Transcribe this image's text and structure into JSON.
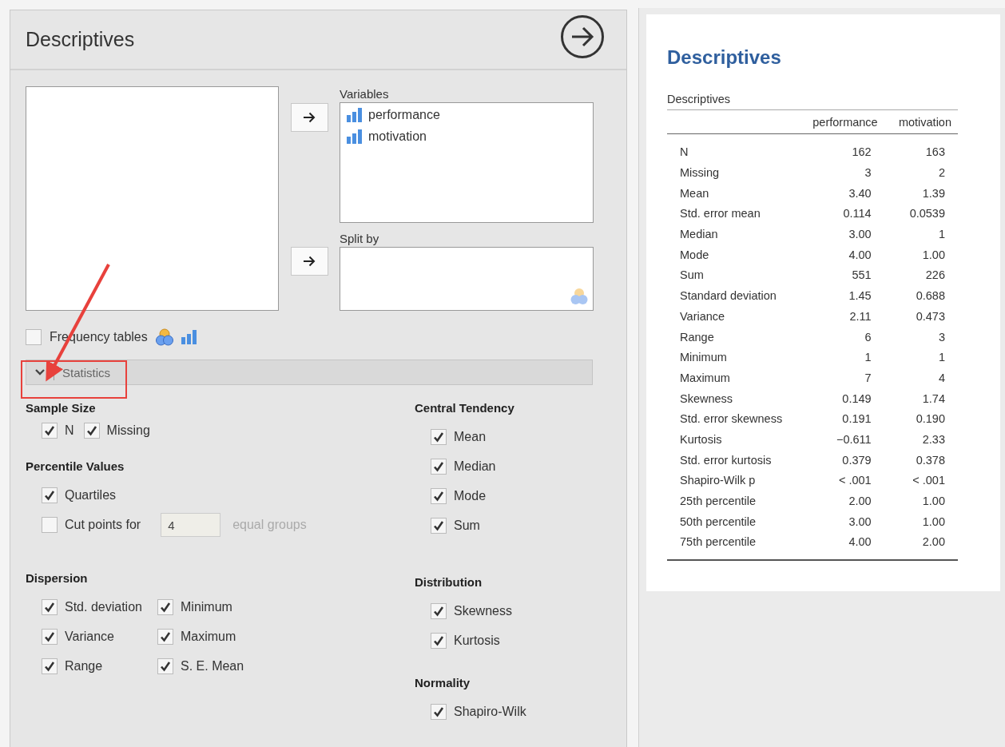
{
  "analysis_panel": {
    "title": "Descriptives",
    "variables": {
      "label": "Variables",
      "items": [
        {
          "name": "performance"
        },
        {
          "name": "motivation"
        }
      ]
    },
    "split_by": {
      "label": "Split by"
    },
    "frequency_tables": {
      "label": "Frequency tables",
      "checked": false
    },
    "statistics_section": {
      "label": "Statistics",
      "expanded": true,
      "left_groups": [
        {
          "title": "Sample Size",
          "kind": "inline",
          "items": [
            {
              "kind": "checkbox",
              "label": "N",
              "checked": true
            },
            {
              "kind": "checkbox",
              "label": "Missing",
              "checked": true
            }
          ]
        },
        {
          "title": "Percentile Values",
          "kind": "stack",
          "items": [
            {
              "kind": "checkbox",
              "label": "Quartiles",
              "checked": true
            },
            {
              "kind": "cut_points",
              "label": "Cut points for",
              "value": "4",
              "suffix": "equal groups",
              "checked": false
            }
          ]
        },
        {
          "title": "Dispersion",
          "kind": "grid",
          "items": [
            {
              "kind": "checkbox",
              "label": "Std. deviation",
              "checked": true
            },
            {
              "kind": "checkbox",
              "label": "Minimum",
              "checked": true
            },
            {
              "kind": "checkbox",
              "label": "Variance",
              "checked": true
            },
            {
              "kind": "checkbox",
              "label": "Maximum",
              "checked": true
            },
            {
              "kind": "checkbox",
              "label": "Range",
              "checked": true
            },
            {
              "kind": "checkbox",
              "label": "S. E. Mean",
              "checked": true
            }
          ]
        }
      ],
      "right_groups": [
        {
          "title": "Central Tendency",
          "kind": "stack",
          "items": [
            {
              "kind": "checkbox",
              "label": "Mean",
              "checked": true
            },
            {
              "kind": "checkbox",
              "label": "Median",
              "checked": true
            },
            {
              "kind": "checkbox",
              "label": "Mode",
              "checked": true
            },
            {
              "kind": "checkbox",
              "label": "Sum",
              "checked": true
            }
          ]
        },
        {
          "title": "Distribution",
          "kind": "stack",
          "items": [
            {
              "kind": "checkbox",
              "label": "Skewness",
              "checked": true
            },
            {
              "kind": "checkbox",
              "label": "Kurtosis",
              "checked": true
            }
          ]
        },
        {
          "title": "Normality",
          "kind": "stack",
          "items": [
            {
              "kind": "checkbox",
              "label": "Shapiro-Wilk",
              "checked": true
            }
          ]
        }
      ]
    }
  },
  "results": {
    "title": "Descriptives",
    "table": {
      "caption": "Descriptives",
      "columns": [
        "performance",
        "motivation"
      ],
      "rows": [
        {
          "label": "N",
          "values": [
            "162",
            "163"
          ]
        },
        {
          "label": "Missing",
          "values": [
            "3",
            "2"
          ]
        },
        {
          "label": "Mean",
          "values": [
            "3.40",
            "1.39"
          ]
        },
        {
          "label": "Std. error mean",
          "values": [
            "0.114",
            "0.0539"
          ]
        },
        {
          "label": "Median",
          "values": [
            "3.00",
            "1"
          ]
        },
        {
          "label": "Mode",
          "values": [
            "4.00",
            "1.00"
          ]
        },
        {
          "label": "Sum",
          "values": [
            "551",
            "226"
          ]
        },
        {
          "label": "Standard deviation",
          "values": [
            "1.45",
            "0.688"
          ]
        },
        {
          "label": "Variance",
          "values": [
            "2.11",
            "0.473"
          ]
        },
        {
          "label": "Range",
          "values": [
            "6",
            "3"
          ]
        },
        {
          "label": "Minimum",
          "values": [
            "1",
            "1"
          ]
        },
        {
          "label": "Maximum",
          "values": [
            "7",
            "4"
          ]
        },
        {
          "label": "Skewness",
          "values": [
            "0.149",
            "1.74"
          ]
        },
        {
          "label": "Std. error skewness",
          "values": [
            "0.191",
            "0.190"
          ]
        },
        {
          "label": "Kurtosis",
          "values": [
            "−0.611",
            "2.33"
          ]
        },
        {
          "label": "Std. error kurtosis",
          "values": [
            "0.379",
            "0.378"
          ]
        },
        {
          "label": "Shapiro-Wilk p",
          "values": [
            "< .001",
            "< .001"
          ]
        },
        {
          "label": "25th percentile",
          "values": [
            "2.00",
            "1.00"
          ]
        },
        {
          "label": "50th percentile",
          "values": [
            "3.00",
            "1.00"
          ]
        },
        {
          "label": "75th percentile",
          "values": [
            "4.00",
            "2.00"
          ]
        }
      ]
    }
  }
}
